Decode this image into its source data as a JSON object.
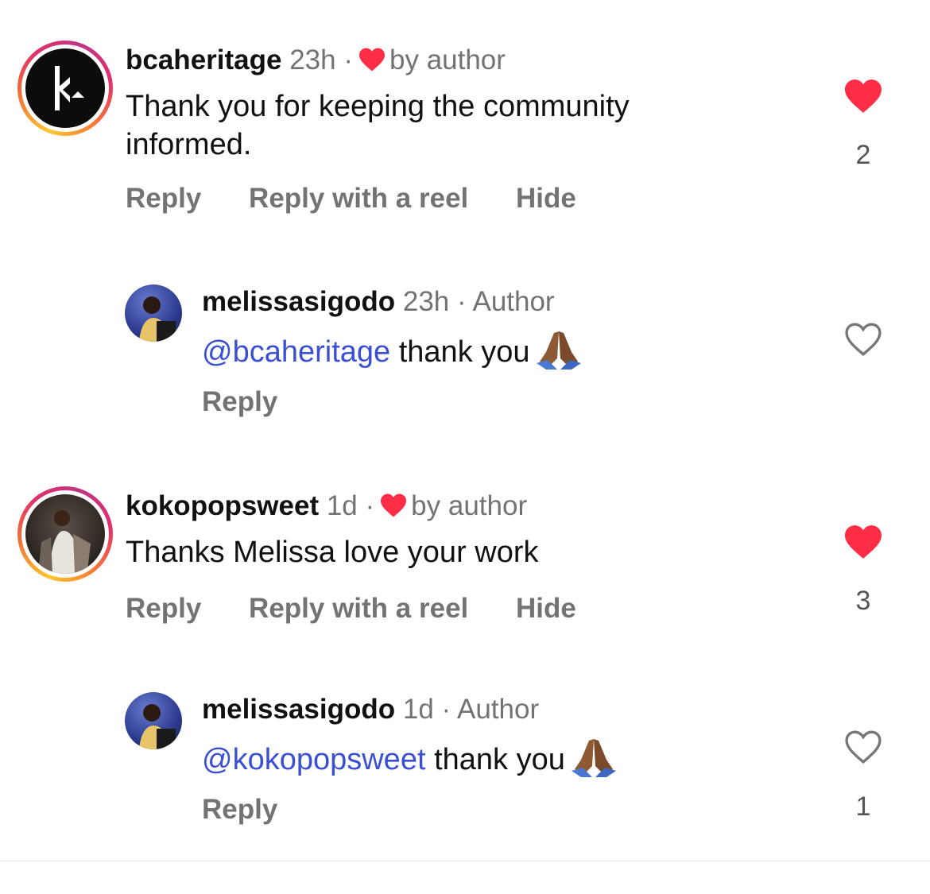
{
  "comments": [
    {
      "username": "bcaheritage",
      "time": "23h",
      "separator": "·",
      "liked_label": "by author",
      "text": "Thank you for keeping the community informed.",
      "actions": [
        "Reply",
        "Reply with a reel",
        "Hide"
      ],
      "like_count": "2",
      "liked": true
    },
    {
      "username": "melissasigodo",
      "time": "23h",
      "separator": "·",
      "author_label": "Author",
      "mention": "@bcaheritage",
      "text": "thank you",
      "actions": [
        "Reply"
      ],
      "liked": false
    },
    {
      "username": "kokopopsweet",
      "time": "1d",
      "separator": "·",
      "liked_label": "by author",
      "text": "Thanks Melissa love your work",
      "actions": [
        "Reply",
        "Reply with a reel",
        "Hide"
      ],
      "like_count": "3",
      "liked": true
    },
    {
      "username": "melissasigodo",
      "time": "1d",
      "separator": "·",
      "author_label": "Author",
      "mention": "@kokopopsweet",
      "text": "thank you",
      "actions": [
        "Reply"
      ],
      "like_count": "1",
      "liked": false
    }
  ],
  "colors": {
    "like_red": "#ff2d46",
    "mention_blue": "#3a4fd4",
    "meta_gray": "#737373"
  },
  "icons": {
    "liked": "heart-filled-icon",
    "unliked": "heart-outline-icon",
    "emoji": "folded-hands-emoji"
  }
}
